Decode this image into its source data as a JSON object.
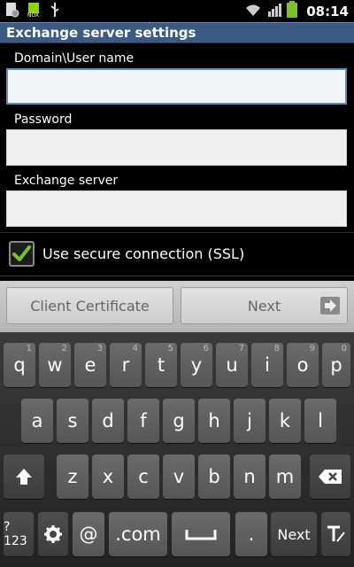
{
  "status_bar": {
    "time": "08:14",
    "icons": [
      "settings-notification-icon",
      "nox-app-icon",
      "usb-icon",
      "wifi-icon",
      "signal-icon",
      "battery-icon"
    ]
  },
  "title": "Exchange server settings",
  "form": {
    "domain_label": "Domain\\User name",
    "domain_value": "",
    "password_label": "Password",
    "password_value": "",
    "server_label": "Exchange server",
    "server_value": "",
    "ssl_label": "Use secure connection (SSL)",
    "ssl_checked": true
  },
  "buttons": {
    "client_certificate": "Client Certificate",
    "next": "Next"
  },
  "keyboard": {
    "row1": [
      {
        "label": "q",
        "sup": "1"
      },
      {
        "label": "w",
        "sup": "2"
      },
      {
        "label": "e",
        "sup": "3"
      },
      {
        "label": "r",
        "sup": "4"
      },
      {
        "label": "t",
        "sup": "5"
      },
      {
        "label": "y",
        "sup": "6"
      },
      {
        "label": "u",
        "sup": "7"
      },
      {
        "label": "i",
        "sup": "8"
      },
      {
        "label": "o",
        "sup": "9"
      },
      {
        "label": "p",
        "sup": "0"
      }
    ],
    "row2": [
      "a",
      "s",
      "d",
      "f",
      "g",
      "h",
      "j",
      "k",
      "l"
    ],
    "row3": [
      "z",
      "x",
      "c",
      "v",
      "b",
      "n",
      "m"
    ],
    "sym_label": "?123",
    "at_label": "@",
    "com_label": ".com",
    "period_label": ".",
    "next_label": "Next"
  },
  "colors": {
    "title_bar": "#3b5a84",
    "checkmark": "#7dc02c",
    "battery": "#7dc02c"
  }
}
